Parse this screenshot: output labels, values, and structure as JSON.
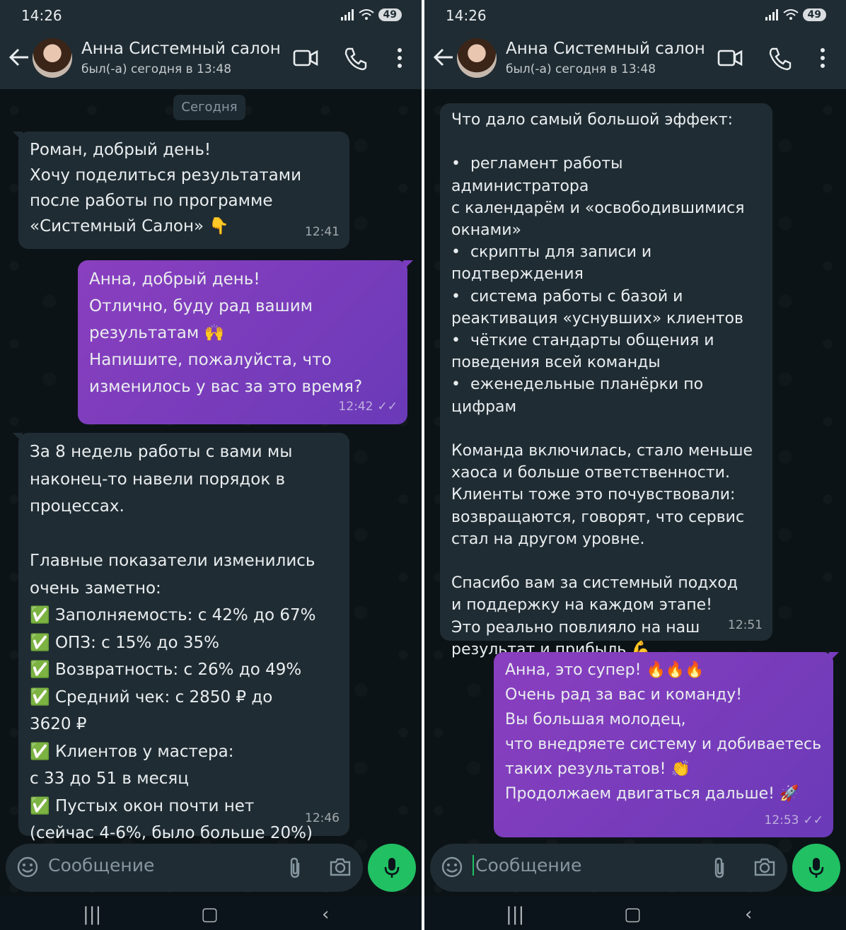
{
  "status": {
    "time": "14:26",
    "battery": "49"
  },
  "contact": {
    "name": "Анна Системный салон",
    "last_seen": "был(-а) сегодня в 13:48"
  },
  "date_chip": "Сегодня",
  "composer": {
    "placeholder": "Сообщение"
  },
  "left_messages": [
    {
      "text": "Роман, добрый день!\nХочу поделиться результатами\nпосле работы по программе\n«Системный Салон» 👇",
      "time": "12:41"
    },
    {
      "text": "Анна, добрый день!\nОтлично, буду рад вашим\nрезультатам 🙌\nНапишите, пожалуйста, что\nизменилось у вас за это время?",
      "time": "12:42"
    },
    {
      "text": "За 8 недель работы с вами мы\nнаконец-то навели порядок в\nпроцессах.\n\nГлавные показатели изменились\nочень заметно:\n✅ Заполняемость: с 42% до 67%\n✅ ОПЗ: с 15% до 35%\n✅ Возвратность: с 26% до 49%\n✅ Средний чек: с 2850 ₽ до\n3620 ₽\n✅ Клиентов у мастера:\nс 33 до 51 в месяц\n✅ Пустых окон почти нет\n(сейчас 4-6%, было больше 20%)",
      "time": "12:46"
    }
  ],
  "right_messages": [
    {
      "text": "Что дало самый большой эффект:\n\n•  регламент работы администратора\nс календарём и «освободившимися\nокнами»\n•  скрипты для записи и\nподтверждения\n•  система работы с базой и\nреактивация «уснувших» клиентов\n•  чёткие стандарты общения и\nповедения всей команды\n•  еженедельные планёрки по цифрам\n\nКоманда включилась, стало меньше\nхаоса и больше ответственности.\nКлиенты тоже это почувствовали:\nвозвращаются, говорят, что сервис\nстал на другом уровне.\n\nСпасибо вам за системный подход\nи поддержку на каждом этапе!\nЭто реально повлияло на наш\nрезультат и прибыль 💪",
      "time": "12:51"
    },
    {
      "text": "Анна, это супер! 🔥🔥🔥\nОчень рад за вас и команду!\nВы большая молодец,\nчто внедряете систему и добиваетесь\nтаких результатов! 👏\nПродолжаем двигаться дальше! 🚀",
      "time": "12:53"
    }
  ]
}
